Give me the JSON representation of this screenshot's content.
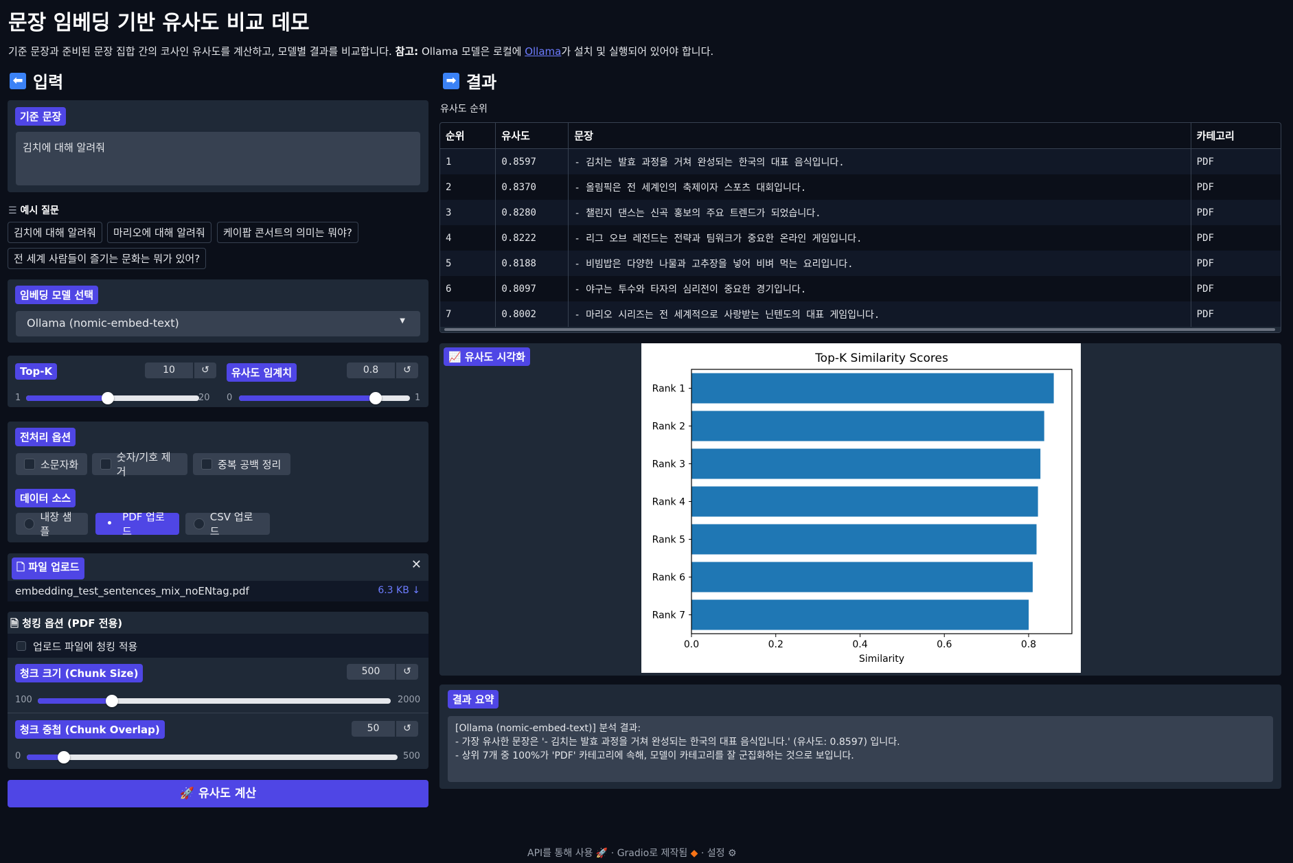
{
  "header": {
    "title": "문장 임베딩 기반 유사도 비교 데모",
    "desc_before": "기준 문장과 준비된 문장 집합 간의 코사인 유사도를 계산하고, 모델별 결과를 비교합니다. ",
    "desc_bold": "참고:",
    "desc_mid": " Ollama 모델은 로컬에 ",
    "desc_link": "Ollama",
    "desc_after": "가 설치 및 실행되어 있어야 합니다."
  },
  "input": {
    "heading": "입력",
    "query_label": "기준 문장",
    "query_value": "김치에 대해 알려줘",
    "examples_label": "예시 질문",
    "examples": [
      "김치에 대해 알려줘",
      "마리오에 대해 알려줘",
      "케이팝 콘서트의 의미는 뭐야?",
      "전 세계 사람들이 즐기는 문화는 뭐가 있어?"
    ],
    "model_label": "임베딩 모델 선택",
    "model_value": "Ollama (nomic-embed-text)",
    "topk_label": "Top-K",
    "topk_value": "10",
    "topk_min": "1",
    "topk_max": "20",
    "topk_level": 0.4737,
    "threshold_label": "유사도 임계치",
    "threshold_value": "0.8",
    "threshold_min": "0",
    "threshold_max": "1",
    "threshold_level": 0.8,
    "reset_symbol": "↺",
    "preprocess_label": "전처리 옵션",
    "preprocess_options": [
      "소문자화",
      "숫자/기호 제거",
      "중복 공백 정리"
    ],
    "source_label": "데이터 소스",
    "source_options": [
      "내장 샘플",
      "PDF 업로드",
      "CSV 업로드"
    ],
    "source_selected": "PDF 업로드",
    "upload_label": "파일 업로드",
    "file_name": "embedding_test_sentences_mix_noENtag.pdf",
    "file_size": "6.3 KB ↓",
    "chunk_header": "청킹 옵션 (PDF 전용)",
    "chunk_apply_label": "업로드 파일에 청킹 적용",
    "chunk_size_label": "청크 크기 (Chunk Size)",
    "chunk_size_value": "500",
    "chunk_size_min": "100",
    "chunk_size_max": "2000",
    "chunk_size_level": 0.2105,
    "chunk_overlap_label": "청크 중첩 (Chunk Overlap)",
    "chunk_overlap_value": "50",
    "chunk_overlap_min": "0",
    "chunk_overlap_max": "500",
    "chunk_overlap_level": 0.1,
    "submit_label": "🚀 유사도 계산"
  },
  "results": {
    "heading": "결과",
    "table_label": "유사도 순위",
    "columns": [
      "순위",
      "유사도",
      "문장",
      "카테고리"
    ],
    "rows": [
      [
        "1",
        "0.8597",
        "- 김치는 발효 과정을 거쳐 완성되는 한국의 대표 음식입니다.",
        "PDF"
      ],
      [
        "2",
        "0.8370",
        "- 올림픽은 전 세계인의 축제이자 스포츠 대회입니다.",
        "PDF"
      ],
      [
        "3",
        "0.8280",
        "- 챌린지 댄스는 신곡 홍보의 주요 트렌드가 되었습니다.",
        "PDF"
      ],
      [
        "4",
        "0.8222",
        "- 리그 오브 레전드는 전략과 팀워크가 중요한 온라인 게임입니다.",
        "PDF"
      ],
      [
        "5",
        "0.8188",
        "- 비빔밥은 다양한 나물과 고추장을 넣어 비벼 먹는 요리입니다.",
        "PDF"
      ],
      [
        "6",
        "0.8097",
        "- 야구는 투수와 타자의 심리전이 중요한 경기입니다.",
        "PDF"
      ],
      [
        "7",
        "0.8002",
        "- 마리오 시리즈는 전 세계적으로 사랑받는 닌텐도의 대표 게임입니다.",
        "PDF"
      ]
    ],
    "viz_label": "유사도 시각화",
    "summary_label": "결과 요약",
    "summary_lines": [
      "[Ollama (nomic-embed-text)] 분석 결과:",
      "- 가장 유사한 문장은 '- 김치는 발효 과정을 거쳐 완성되는 한국의 대표 음식입니다.' (유사도: 0.8597) 입니다.",
      "- 상위 7개 중 100%가 'PDF' 카테고리에 속해, 모델이 카테고리를 잘 군집화하는 것으로 보입니다."
    ]
  },
  "chart_data": {
    "type": "bar",
    "orientation": "horizontal",
    "title": "Top-K Similarity Scores",
    "xlabel": "Similarity",
    "ylabel": "",
    "categories": [
      "Rank 1",
      "Rank 2",
      "Rank 3",
      "Rank 4",
      "Rank 5",
      "Rank 6",
      "Rank 7"
    ],
    "values": [
      0.8597,
      0.837,
      0.828,
      0.8222,
      0.8188,
      0.8097,
      0.8002
    ],
    "xlim": [
      0,
      0.9027
    ],
    "xticks": [
      "0.0",
      "0.2",
      "0.4",
      "0.6",
      "0.8"
    ],
    "bar_color": "#1f77b4",
    "grid": false
  },
  "footer": {
    "api": "API를 통해 사용",
    "built": "Gradio로 제작됨",
    "settings": "설정",
    "sep": "·"
  },
  "colors": {
    "accent": "#4f46e5",
    "panel": "#1f2937",
    "background": "#0b0f19"
  }
}
